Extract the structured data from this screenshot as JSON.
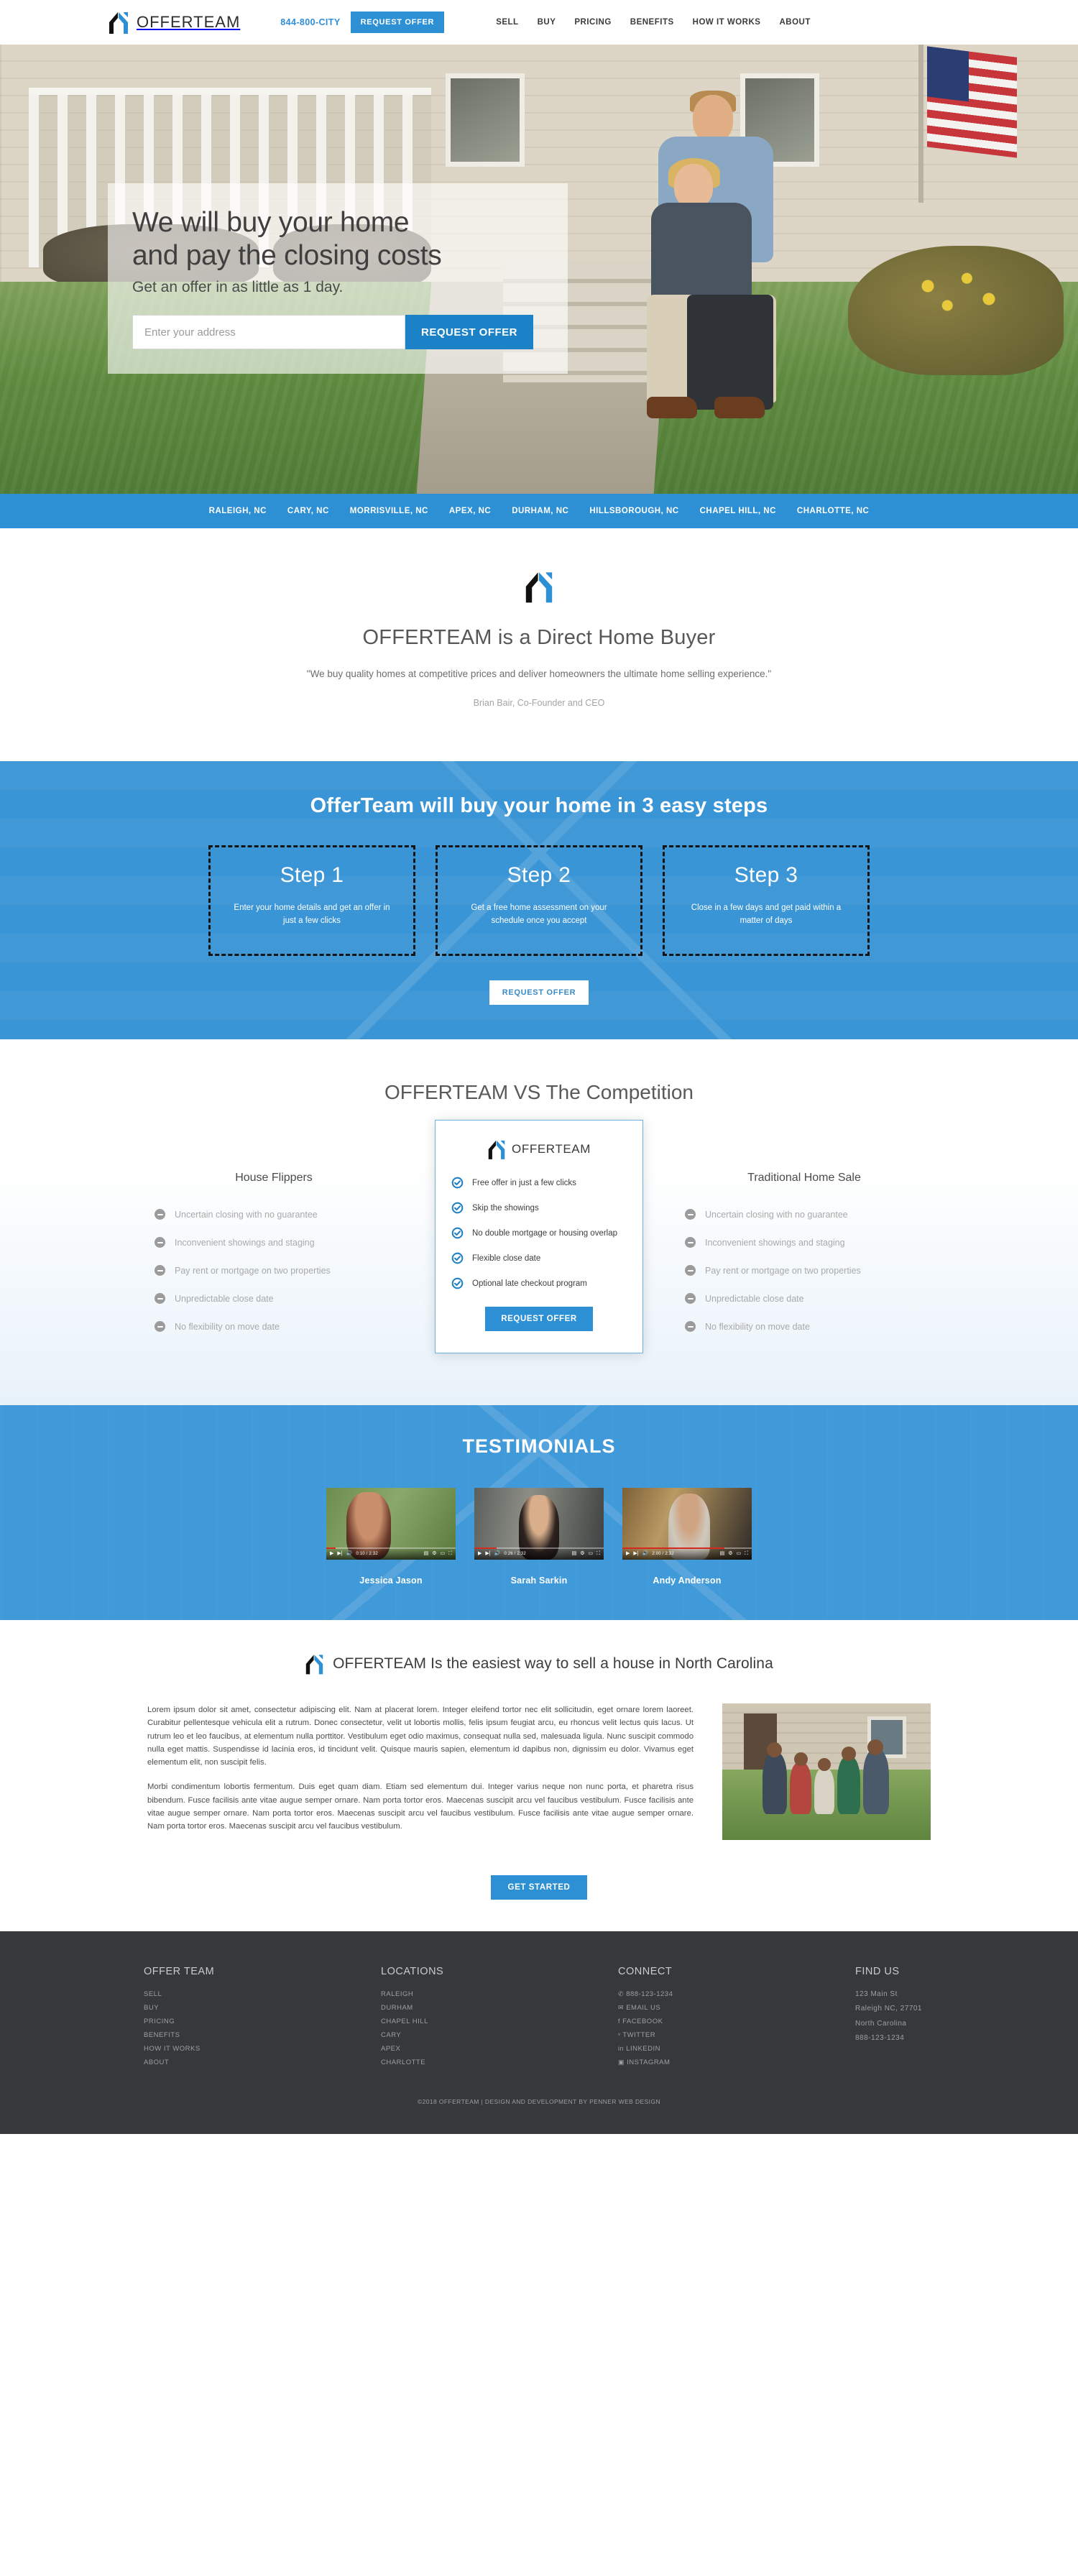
{
  "header": {
    "brand": "OFFERTEAM",
    "logo_icon": "house-logo-icon",
    "phone": "844-800-CITY",
    "cta": "REQUEST OFFER",
    "nav": [
      {
        "label": "SELL"
      },
      {
        "label": "BUY"
      },
      {
        "label": "PRICING"
      },
      {
        "label": "BENEFITS"
      },
      {
        "label": "HOW IT WORKS"
      },
      {
        "label": "ABOUT"
      }
    ]
  },
  "hero": {
    "headline_line1": "We will buy your home",
    "headline_line2": "and pay the closing costs",
    "subhead": "Get an offer in as little as 1 day.",
    "address_placeholder": "Enter your address",
    "address_value": "",
    "cta": "REQUEST OFFER"
  },
  "citybar": {
    "cities": [
      "RALEIGH, NC",
      "CARY, NC",
      "MORRISVILLE, NC",
      "APEX, NC",
      "DURHAM, NC",
      "HILLSBOROUGH, NC",
      "CHAPEL HILL, NC",
      "CHARLOTTE, NC"
    ]
  },
  "direct": {
    "heading": "OFFERTEAM is a Direct Home Buyer",
    "quote": "\"We buy quality homes at competitive prices and deliver homeowners the ultimate home selling experience.\"",
    "attribution": "Brian Bair, Co-Founder and CEO"
  },
  "steps": {
    "heading": "OfferTeam will buy your home in 3 easy steps",
    "cards": [
      {
        "title": "Step 1",
        "desc": "Enter your home details and get an offer in just a few clicks"
      },
      {
        "title": "Step 2",
        "desc": "Get a free home assessment on your schedule once you accept"
      },
      {
        "title": "Step 3",
        "desc": "Close in a few days and get paid within a matter of days"
      }
    ],
    "cta": "REQUEST OFFER"
  },
  "compare": {
    "heading": "OFFERTEAM VS The Competition",
    "left": {
      "title": "House Flippers",
      "items": [
        "Uncertain closing with no guarantee",
        "Inconvenient showings and staging",
        "Pay rent or mortgage on two properties",
        "Unpredictable close date",
        "No flexibility on move date"
      ]
    },
    "right": {
      "title": "Traditional Home Sale",
      "items": [
        "Uncertain closing with no guarantee",
        "Inconvenient showings and staging",
        "Pay rent or mortgage on two properties",
        "Unpredictable close date",
        "No flexibility on move date"
      ]
    },
    "center": {
      "brand": "OFFERTEAM",
      "items": [
        "Free offer in just a few clicks",
        "Skip the showings",
        "No double mortgage or housing overlap",
        "Flexible close date",
        "Optional late checkout program"
      ],
      "cta": "REQUEST OFFER"
    }
  },
  "testimonials": {
    "heading": "TESTIMONIALS",
    "videos": [
      {
        "name": "Jessica Jason",
        "time": "0:10 / 2:32",
        "progress": 7
      },
      {
        "name": "Sarah Sarkin",
        "time": "0:26 / 2:32",
        "progress": 17
      },
      {
        "name": "Andy Anderson",
        "time": "2:00 / 2:32",
        "progress": 79
      }
    ]
  },
  "easiest": {
    "heading": "OFFERTEAM Is the easiest way to sell a house in North Carolina",
    "paragraph1": "Lorem ipsum dolor sit amet, consectetur adipiscing elit. Nam at placerat lorem. Integer eleifend tortor nec elit sollicitudin, eget ornare lorem laoreet. Curabitur pellentesque vehicula elit a rutrum. Donec consectetur, velit ut lobortis mollis, felis ipsum feugiat arcu, eu rhoncus velit lectus quis lacus. Ut rutrum leo et leo faucibus, at elementum nulla porttitor. Vestibulum eget odio maximus, consequat nulla sed, malesuada ligula. Nunc suscipit commodo nulla eget mattis. Suspendisse id lacinia eros, id tincidunt velit. Quisque mauris sapien, elementum id dapibus non, dignissim eu dolor. Vivamus eget elementum elit, non suscipit felis.",
    "paragraph2": "Morbi condimentum lobortis fermentum. Duis eget quam diam. Etiam sed elementum dui. Integer varius neque non nunc porta, et pharetra risus bibendum. Fusce facilisis ante vitae augue semper ornare. Nam porta tortor eros. Maecenas suscipit arcu vel faucibus vestibulum. Fusce facilisis ante vitae augue semper ornare. Nam porta tortor eros. Maecenas suscipit arcu vel faucibus vestibulum. Fusce facilisis ante vitae augue semper ornare. Nam porta tortor eros. Maecenas suscipit arcu vel faucibus vestibulum.",
    "cta": "GET STARTED"
  },
  "footer": {
    "offerteam": {
      "title": "OFFER TEAM",
      "links": [
        "SELL",
        "BUY",
        "PRICING",
        "BENEFITS",
        "HOW IT WORKS",
        "ABOUT"
      ]
    },
    "locations": {
      "title": "LOCATIONS",
      "links": [
        "RALEIGH",
        "DURHAM",
        "CHAPEL HILL",
        "CARY",
        "APEX",
        "CHARLOTTE"
      ]
    },
    "connect": {
      "title": "CONNECT",
      "links": [
        {
          "icon": "phone-icon",
          "glyph": "✆",
          "label": "888-123-1234"
        },
        {
          "icon": "envelope-icon",
          "glyph": "✉",
          "label": "EMAIL US"
        },
        {
          "icon": "facebook-icon",
          "glyph": "f",
          "label": "FACEBOOK"
        },
        {
          "icon": "twitter-icon",
          "glyph": "ᵛ",
          "label": "TWITTER"
        },
        {
          "icon": "linkedin-icon",
          "glyph": "in",
          "label": "LINKEDIN"
        },
        {
          "icon": "instagram-icon",
          "glyph": "▣",
          "label": "INSTAGRAM"
        }
      ]
    },
    "findus": {
      "title": "FIND US",
      "lines": [
        "123 Main St",
        "Raleigh NC, 27701",
        "North Carolina",
        "888-123-1234"
      ]
    },
    "copyright": "©2018 OFFERTEAM | DESIGN AND DEVELOPMENT BY PENNER WEB DESIGN"
  },
  "colors": {
    "accent_blue": "#2e90d4",
    "hero_button_blue": "#1c82c8",
    "steps_blue": "#3a95d6",
    "testimonials_blue": "#4099d8",
    "footer_dark": "#35393b",
    "logo_black": "#111111",
    "logo_blue": "#2e90d4"
  }
}
